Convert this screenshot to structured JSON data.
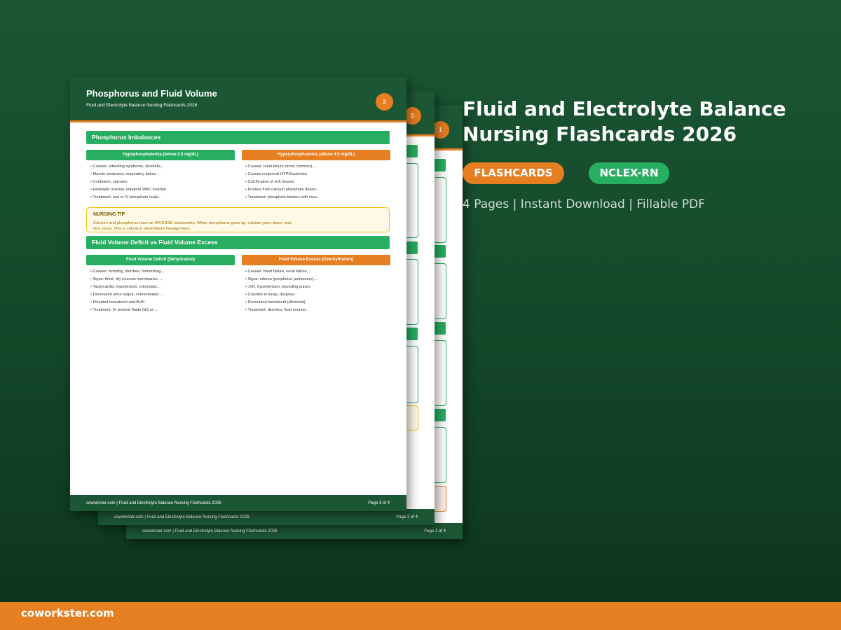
{
  "product": {
    "title": "Fluid and Electrolyte Balance Nursing Flashcards 2026",
    "tag_primary": "FLASHCARDS",
    "tag_secondary": "NCLEX-RN",
    "subtitle": "4 Pages | Instant Download | Fillable PDF",
    "brand": "coworkster.com"
  },
  "colors": {
    "background": "#174d2d",
    "header_green": "#1c5735",
    "accent_green": "#27ae60",
    "accent_orange": "#e67e22",
    "tip_yellow": "#f1c40f"
  },
  "pages": {
    "page1": {
      "badge": "1",
      "footer_text": "coworkster.com | Fluid and Electrolyte Balance Nursing Flashcards 2026",
      "footer_page": "Page 1 of 4"
    },
    "page2": {
      "badge": "2",
      "footer_text": "coworkster.com | Fluid and Electrolyte Balance Nursing Flashcards 2026",
      "footer_page": "Page 2 of 4"
    },
    "page3": {
      "badge": "3",
      "title": "Phosphorus and Fluid Volume",
      "subtitle": "Fluid and Electrolyte Balance Nursing Flashcards 2026",
      "section1": {
        "title": "Phosphorus Imbalances",
        "left": {
          "heading": "Hypophosphatemia (below 2.5 mg/dL)",
          "items": [
            "Causes: refeeding syndrome, alcoholis...",
            "Muscle weakness, respiratory failure ...",
            "Confusion, seizures",
            "Hemolytic anemia, impaired WBC function",
            "Treatment: oral or IV phosphate repla..."
          ]
        },
        "right": {
          "heading": "Hyperphosphatemia (above 4.5 mg/dL)",
          "items": [
            "Causes: renal failure (most common), ...",
            "Causes reciprocal HYPOcalcemia",
            "Calcification of soft tissues",
            "Pruritus from calcium phosphate depos...",
            "Treatment: phosphate binders with mea..."
          ]
        }
      },
      "tip": {
        "title": "NURSING TIP",
        "text": "Calcium and phosphorus have an INVERSE relationship. When phosphorus goes up, calcium goes down, and vice versa. This is critical in renal failure management."
      },
      "section2": {
        "title": "Fluid Volume Deficit vs Fluid Volume Excess",
        "left": {
          "heading": "Fluid Volume Deficit (Dehydration)",
          "items": [
            "Causes: vomiting, diarrhea, hemorrhag...",
            "Signs: thirst, dry mucous membranes, ...",
            "Tachycardia, hypotension, orthostatic...",
            "Decreased urine output, concentrated ...",
            "Elevated hematocrit and BUN",
            "Treatment: IV isotonic fluids (NS or ..."
          ]
        },
        "right": {
          "heading": "Fluid Volume Excess (Overhydration)",
          "items": [
            "Causes: heart failure, renal failure,...",
            "Signs: edema (peripheral, pulmonary),...",
            "JVD, hypertension, bounding pulses",
            "Crackles in lungs, dyspnea",
            "Decreased hematocrit (dilutional)",
            "Treatment: diuretics, fluid restricti..."
          ]
        }
      },
      "footer_text": "coworkster.com | Fluid and Electrolyte Balance Nursing Flashcards 2026",
      "footer_page": "Page 3 of 4"
    }
  }
}
